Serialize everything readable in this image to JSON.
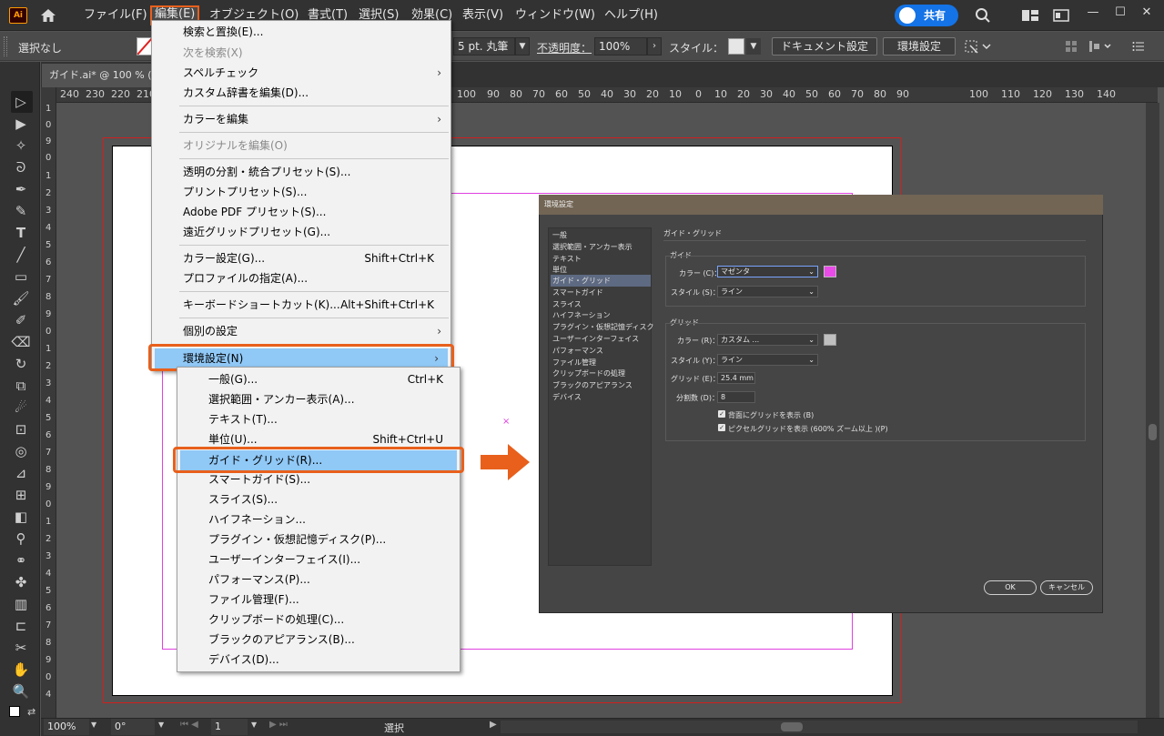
{
  "menubar": {
    "app_logo": "Ai",
    "items": [
      "ファイル(F)",
      "編集(E)",
      "オブジェクト(O)",
      "書式(T)",
      "選択(S)",
      "効果(C)",
      "表示(V)",
      "ウィンドウ(W)",
      "ヘルプ(H)"
    ],
    "share_label": "共有",
    "icons": {
      "home": "home-icon",
      "search": "search-icon",
      "arrange": "arrange-icon",
      "panel": "panel-icon"
    },
    "window_controls": [
      "—",
      "☐",
      "✕"
    ]
  },
  "controlbar": {
    "selection": "選択なし",
    "stroke_weight": "5 pt. 丸筆",
    "opacity_label": "不透明度：",
    "opacity_value": "100%",
    "style_label": "スタイル：",
    "document_setup": "ドキュメント設定",
    "preferences": "環境設定"
  },
  "document": {
    "tab_title": "ガイド.ai* @ 100 % (CMYK"
  },
  "ruler_h": [
    "240",
    "230",
    "220",
    "210",
    "100",
    "90",
    "80",
    "70",
    "60",
    "50",
    "40",
    "30",
    "20",
    "10",
    "0",
    "10",
    "20",
    "30",
    "40",
    "50",
    "60",
    "70",
    "80",
    "90",
    "100",
    "110",
    "120",
    "130",
    "140"
  ],
  "ruler_v": [
    "1",
    "0",
    "9",
    "0",
    "1",
    "2",
    "3",
    "4",
    "5",
    "6",
    "7",
    "8",
    "9",
    "0",
    "1",
    "2",
    "3",
    "4",
    "5",
    "6",
    "7",
    "8",
    "9",
    "0",
    "1",
    "2",
    "3",
    "4",
    "5",
    "6",
    "7",
    "8",
    "9",
    "0",
    "4"
  ],
  "edit_menu": {
    "items": [
      {
        "label": "検索と置換(E)...",
        "shortcut": "",
        "submenu": false,
        "disabled": false
      },
      {
        "label": "次を検索(X)",
        "shortcut": "",
        "submenu": false,
        "disabled": true
      },
      {
        "label": "スペルチェック",
        "shortcut": "",
        "submenu": true,
        "disabled": false
      },
      {
        "label": "カスタム辞書を編集(D)...",
        "shortcut": "",
        "submenu": false,
        "disabled": false
      },
      {
        "label": "カラーを編集",
        "shortcut": "",
        "submenu": true,
        "disabled": false
      },
      {
        "label": "オリジナルを編集(O)",
        "shortcut": "",
        "submenu": false,
        "disabled": true
      },
      {
        "label": "透明の分割・統合プリセット(S)...",
        "shortcut": "",
        "submenu": false,
        "disabled": false
      },
      {
        "label": "プリントプリセット(S)...",
        "shortcut": "",
        "submenu": false,
        "disabled": false
      },
      {
        "label": "Adobe PDF プリセット(S)...",
        "shortcut": "",
        "submenu": false,
        "disabled": false
      },
      {
        "label": "遠近グリッドプリセット(G)...",
        "shortcut": "",
        "submenu": false,
        "disabled": false
      },
      {
        "label": "カラー設定(G)...",
        "shortcut": "Shift+Ctrl+K",
        "submenu": false,
        "disabled": false
      },
      {
        "label": "プロファイルの指定(A)...",
        "shortcut": "",
        "submenu": false,
        "disabled": false
      },
      {
        "label": "キーボードショートカット(K)...",
        "shortcut": "Alt+Shift+Ctrl+K",
        "submenu": false,
        "disabled": false
      },
      {
        "label": "個別の設定",
        "shortcut": "",
        "submenu": true,
        "disabled": false
      },
      {
        "label": "環境設定(N)",
        "shortcut": "",
        "submenu": true,
        "disabled": false
      }
    ]
  },
  "prefs_submenu": {
    "items": [
      {
        "label": "一般(G)...",
        "shortcut": "Ctrl+K"
      },
      {
        "label": "選択範囲・アンカー表示(A)...",
        "shortcut": ""
      },
      {
        "label": "テキスト(T)...",
        "shortcut": ""
      },
      {
        "label": "単位(U)...",
        "shortcut": "Shift+Ctrl+U"
      },
      {
        "label": "ガイド・グリッド(R)...",
        "shortcut": ""
      },
      {
        "label": "スマートガイド(S)...",
        "shortcut": ""
      },
      {
        "label": "スライス(S)...",
        "shortcut": ""
      },
      {
        "label": "ハイフネーション...",
        "shortcut": ""
      },
      {
        "label": "プラグイン・仮想記憶ディスク(P)...",
        "shortcut": ""
      },
      {
        "label": "ユーザーインターフェイス(I)...",
        "shortcut": ""
      },
      {
        "label": "パフォーマンス(P)...",
        "shortcut": ""
      },
      {
        "label": "ファイル管理(F)...",
        "shortcut": ""
      },
      {
        "label": "クリップボードの処理(C)...",
        "shortcut": ""
      },
      {
        "label": "ブラックのアピアランス(B)...",
        "shortcut": ""
      },
      {
        "label": "デバイス(D)...",
        "shortcut": ""
      }
    ]
  },
  "dialog": {
    "title": "環境設定",
    "categories": [
      "一般",
      "選択範囲・アンカー表示",
      "テキスト",
      "単位",
      "ガイド・グリッド",
      "スマートガイド",
      "スライス",
      "ハイフネーション",
      "プラグイン・仮想記憶ディスク",
      "ユーザーインターフェイス",
      "パフォーマンス",
      "ファイル管理",
      "クリップボードの処理",
      "ブラックのアピアランス",
      "デバイス"
    ],
    "section_title": "ガイド・グリッド",
    "guide": {
      "label": "ガイド",
      "color_label": "カラー (C)：",
      "color_value": "マゼンタ",
      "color_swatch": "#e84be8",
      "style_label": "スタイル (S)：",
      "style_value": "ライン"
    },
    "grid": {
      "label": "グリッド",
      "color_label": "カラー (R)：",
      "color_value": "カスタム ...",
      "color_swatch": "#c0c0c0",
      "style_label": "スタイル (Y)：",
      "style_value": "ライン",
      "interval_label": "グリッド (E)：",
      "interval_value": "25.4 mm",
      "subdiv_label": "分割数 (D)：",
      "subdiv_value": "8",
      "back_label": "背面にグリッドを表示 (B)",
      "pixel_label": "ピクセルグリッドを表示 (600% ズーム以上 )(P)"
    },
    "ok": "OK",
    "cancel": "キャンセル"
  },
  "statusbar": {
    "zoom": "100%",
    "rotate": "0°",
    "artboard": "1",
    "tool": "選択"
  },
  "colors": {
    "accent": "#e8601c",
    "highlight": "#90c8f6",
    "guide": "#e040e0"
  }
}
